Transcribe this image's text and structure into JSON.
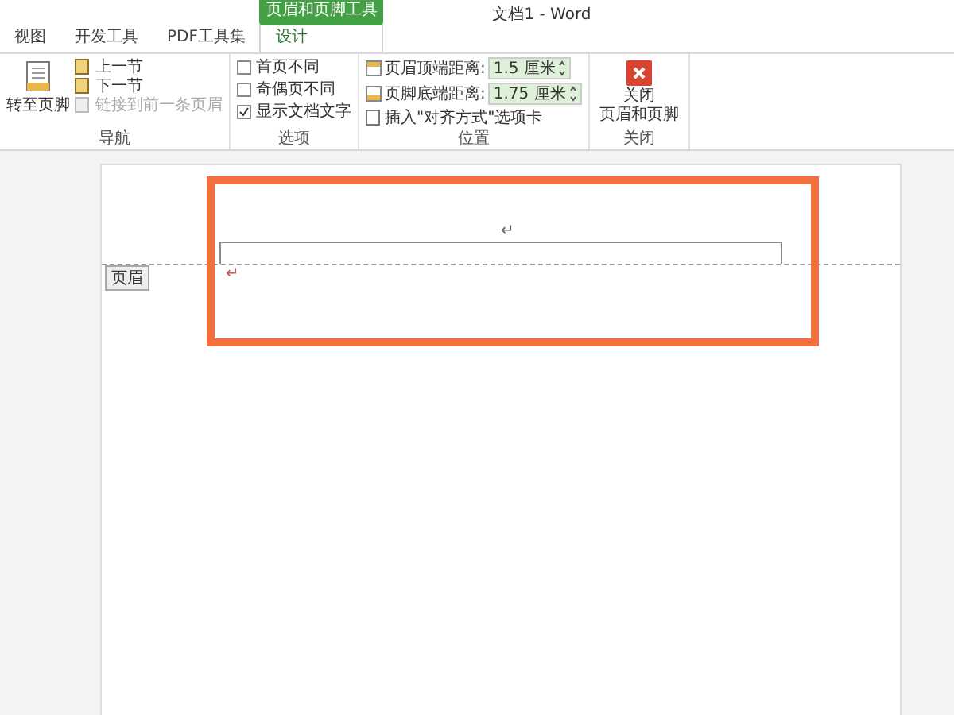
{
  "window": {
    "title": "文档1 - Word",
    "context_tab": "页眉和页脚工具"
  },
  "tabs": [
    {
      "label": "视图",
      "selected": false
    },
    {
      "label": "开发工具",
      "selected": false
    },
    {
      "label": "PDF工具集",
      "selected": false
    },
    {
      "label": "设计",
      "selected": true
    }
  ],
  "ribbon": {
    "navigation": {
      "label": "导航",
      "big_button": "转至页脚",
      "buttons": [
        {
          "label": "上一节",
          "disabled": false
        },
        {
          "label": "下一节",
          "disabled": false
        },
        {
          "label": "链接到前一条页眉",
          "disabled": true
        }
      ]
    },
    "options": {
      "label": "选项",
      "checkboxes": [
        {
          "label": "首页不同",
          "checked": false
        },
        {
          "label": "奇偶页不同",
          "checked": false
        },
        {
          "label": "显示文档文字",
          "checked": true
        }
      ]
    },
    "position": {
      "label": "位置",
      "spinners": [
        {
          "label": "页眉顶端距离:",
          "value": "1.5 厘米"
        },
        {
          "label": "页脚底端距离:",
          "value": "1.75 厘米"
        }
      ],
      "insert_button": "插入\"对齐方式\"选项卡"
    },
    "close": {
      "label": "关闭",
      "button_lines": [
        "关闭",
        "页眉和页脚"
      ]
    }
  },
  "document": {
    "header_tag": "页眉",
    "header_mark": "↵",
    "body_mark": "↵"
  }
}
